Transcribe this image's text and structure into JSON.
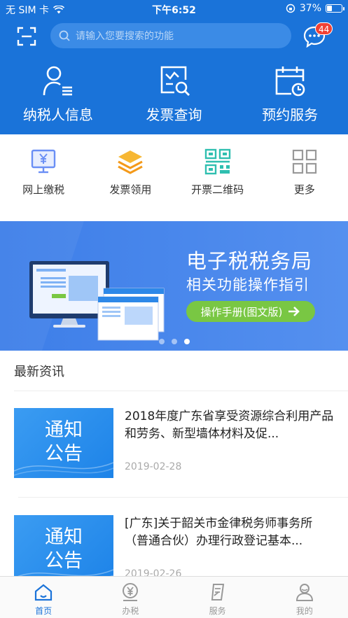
{
  "statusbar": {
    "carrier": "无 SIM 卡",
    "time": "下午6:52",
    "battery_percent": "37%",
    "battery_level": 0.37
  },
  "header": {
    "search_placeholder": "请输入您要搜索的功能",
    "message_badge": "44",
    "big_actions": [
      {
        "label": "纳税人信息",
        "icon": "person-list-icon"
      },
      {
        "label": "发票查询",
        "icon": "invoice-search-icon"
      },
      {
        "label": "预约服务",
        "icon": "calendar-clock-icon"
      }
    ]
  },
  "quick_actions": [
    {
      "label": "网上缴税",
      "icon": "monitor-yen-icon"
    },
    {
      "label": "发票领用",
      "icon": "layers-icon"
    },
    {
      "label": "开票二维码",
      "icon": "qrcode-icon"
    },
    {
      "label": "更多",
      "icon": "grid-icon"
    }
  ],
  "banner": {
    "title": "电子税税务局",
    "subtitle": "相关功能操作指引",
    "cta": "操作手册(图文版)",
    "active_dot": 3,
    "dot_count": 3
  },
  "news": {
    "header": "最新资讯",
    "items": [
      {
        "thumb_line1": "通知",
        "thumb_line2": "公告",
        "title": "2018年度广东省享受资源综合利用产品和劳务、新型墙体材料及促...",
        "date": "2019-02-28"
      },
      {
        "thumb_line1": "通知",
        "thumb_line2": "公告",
        "title": "[广东]关于韶关市金律税务师事务所（普通合伙）办理行政登记基本...",
        "date": "2019-02-26"
      }
    ]
  },
  "tabbar": [
    {
      "label": "首页",
      "icon": "home-icon",
      "active": true
    },
    {
      "label": "办税",
      "icon": "tax-yen-icon",
      "active": false
    },
    {
      "label": "服务",
      "icon": "service-icon",
      "active": false
    },
    {
      "label": "我的",
      "icon": "profile-icon",
      "active": false
    }
  ],
  "colors": {
    "primary": "#1a73d9",
    "banner": "#4a88ec",
    "cta": "#79c743",
    "badge": "#f04134"
  }
}
